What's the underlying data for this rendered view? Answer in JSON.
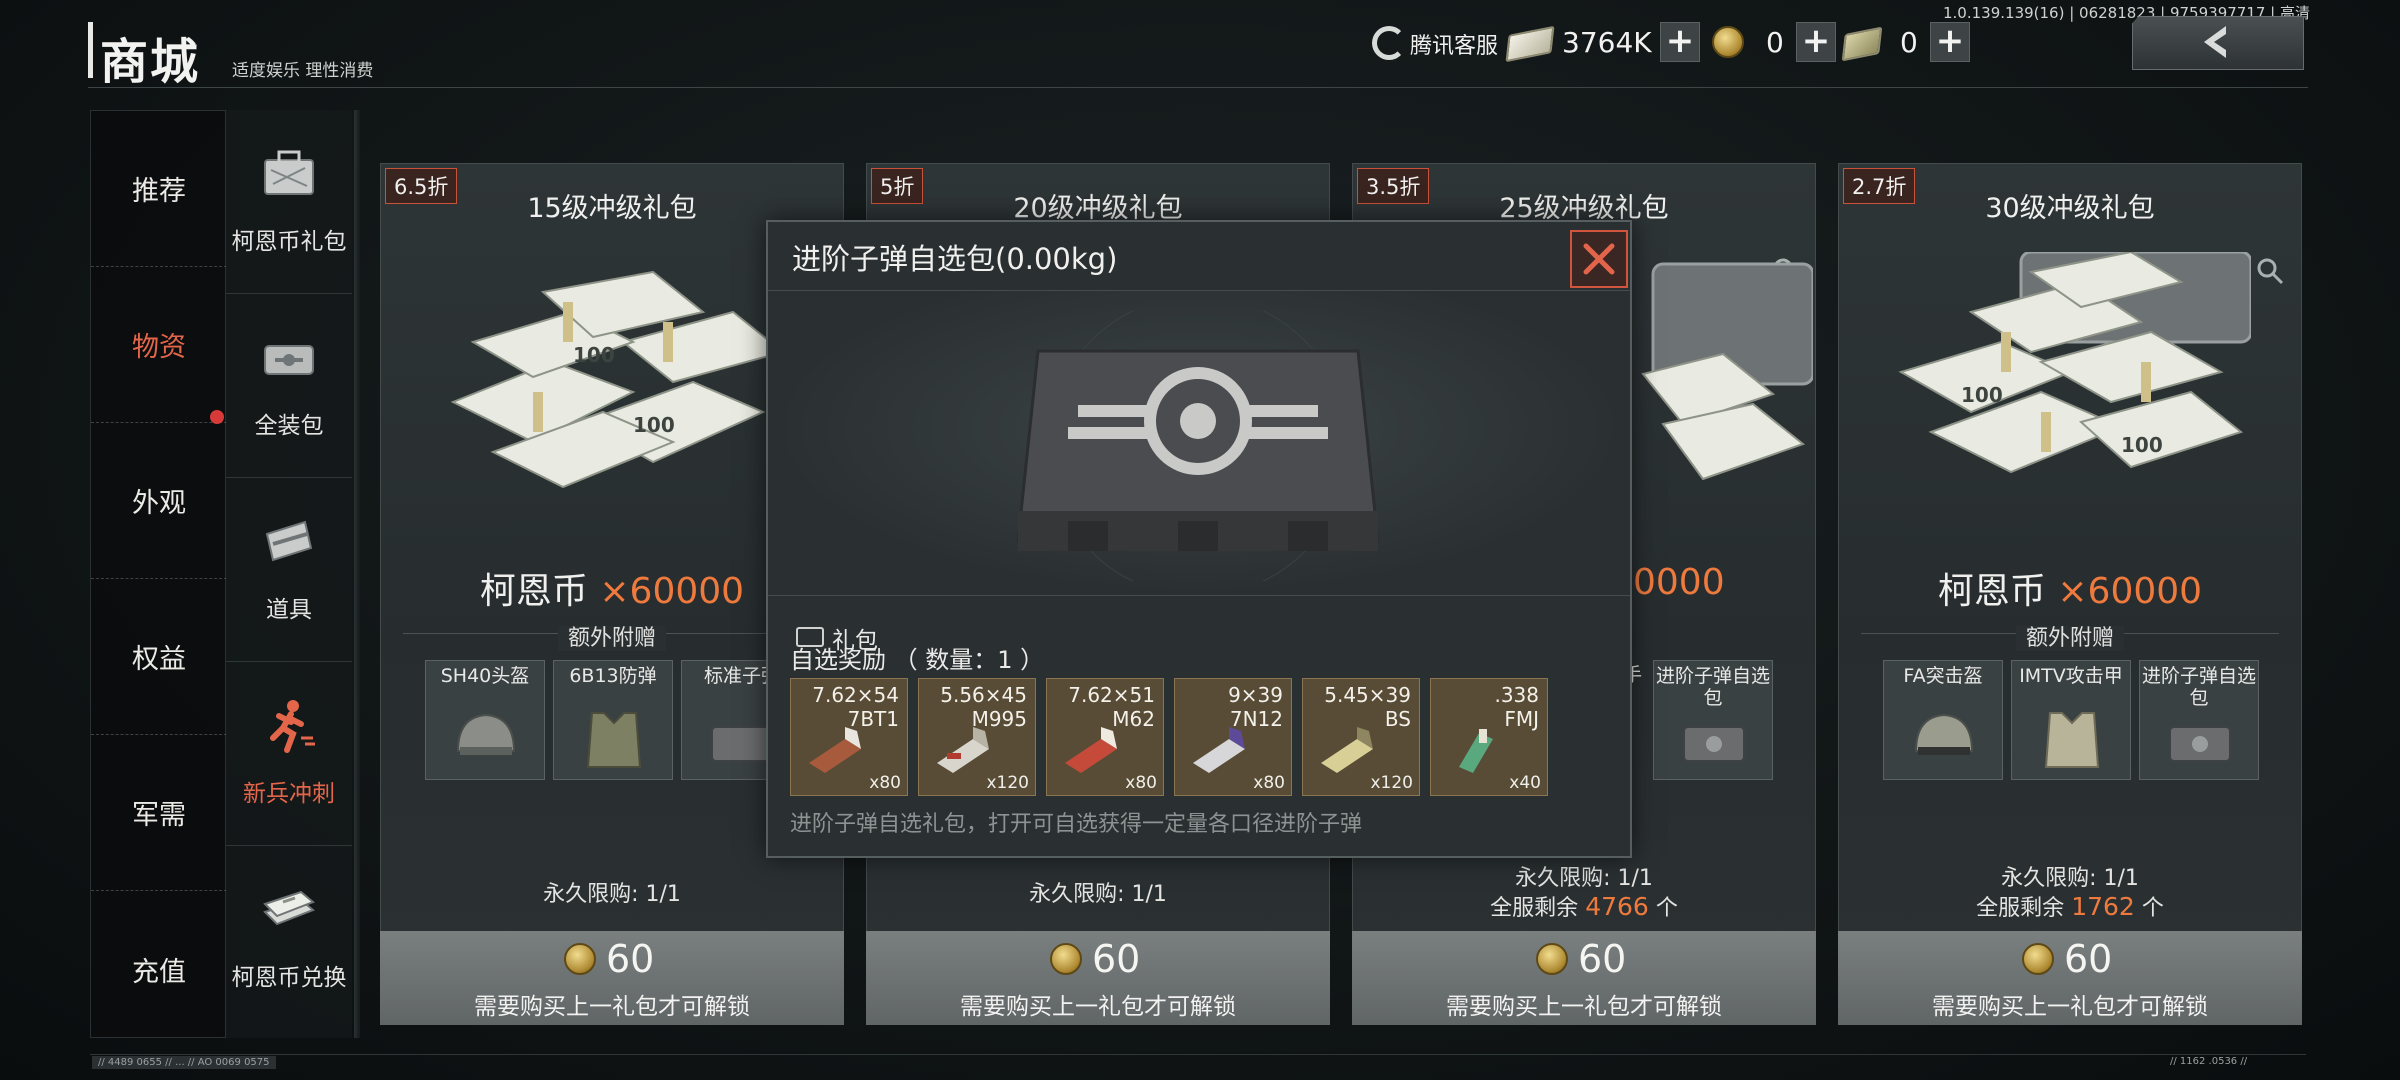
{
  "version": "1.0.139.139(16) | 06281823 | 9759397717 | 高清",
  "header": {
    "title": "商城",
    "subtitle": "适度娱乐 理性消费",
    "service_label": "腾讯客服",
    "cash_amount": "3764K",
    "coins": "0",
    "tickets": "0",
    "plus": "+"
  },
  "nav": {
    "items": [
      {
        "label": "推荐"
      },
      {
        "label": "物资"
      },
      {
        "label": "外观"
      },
      {
        "label": "权益"
      },
      {
        "label": "军需"
      },
      {
        "label": "充值"
      }
    ],
    "active": "物资"
  },
  "subnav": {
    "items": [
      {
        "label": "柯恩币礼包",
        "icon": "briefcase-icon"
      },
      {
        "label": "全装包",
        "icon": "crate-icon"
      },
      {
        "label": "道具",
        "icon": "card-icon"
      },
      {
        "label": "新兵冲刺",
        "icon": "runner-icon"
      },
      {
        "label": "柯恩币兑换",
        "icon": "cash-stack-icon"
      }
    ],
    "active": "新兵冲刺"
  },
  "cards": [
    {
      "discount": "6.5折",
      "title": "15级冲级礼包",
      "currency": "柯恩币",
      "multiplier": "×60000",
      "bonus_title": "额外附赠",
      "gifts": [
        "SH40头盔",
        "6B13防弹",
        "标准子弹"
      ],
      "limit": "永久限购: 1/1",
      "price": "60",
      "buy_hint": "需要购买上一礼包才可解锁"
    },
    {
      "discount": "5折",
      "title": "20级冲级礼包",
      "limit": "永久限购: 1/1",
      "price": "60",
      "buy_hint": "需要购买上一礼包才可解锁"
    },
    {
      "discount": "3.5折",
      "title": "25级冲级礼包",
      "amount_tail": "0000",
      "gift_tail": "进阶子弹自选包",
      "gift_tail_prefix": "手",
      "limit": "永久限购: 1/1",
      "remain_prefix": "全服剩余",
      "remain_count": "4766",
      "remain_unit": "个",
      "price": "60",
      "buy_hint": "需要购买上一礼包才可解锁"
    },
    {
      "discount": "2.7折",
      "title": "30级冲级礼包",
      "currency": "柯恩币",
      "multiplier": "×60000",
      "bonus_title": "额外附赠",
      "gifts": [
        "FA突击盔",
        "IMTV攻击甲",
        "进阶子弹自选包"
      ],
      "limit": "永久限购: 1/1",
      "remain_prefix": "全服剩余",
      "remain_count": "1762",
      "remain_unit": "个",
      "price": "60",
      "buy_hint": "需要购买上一礼包才可解锁"
    }
  ],
  "popup": {
    "title": "进阶子弹自选包(0.00kg)",
    "type": "礼包",
    "reward_title": "自选奖励 （ 数量：1 ）",
    "items": [
      {
        "caliber": "7.62×54\n7BT1",
        "qty": "x80"
      },
      {
        "caliber": "5.56×45\nM995",
        "qty": "x120"
      },
      {
        "caliber": "7.62×51\nM62",
        "qty": "x80"
      },
      {
        "caliber": "9×39\n7N12",
        "qty": "x80"
      },
      {
        "caliber": "5.45×39\nBS",
        "qty": "x120"
      },
      {
        "caliber": ".338\nFMJ",
        "qty": "x40"
      }
    ],
    "description": "进阶子弹自选礼包，打开可自选获得一定量各口径进阶子弹"
  },
  "footer": {
    "left_ticker": "// 4489 0655 // ... // AO 0069 0575",
    "right_ticker": "// 1162 .0536 //"
  },
  "colors": {
    "accent": "#ef7a3e",
    "active_nav": "#e4664a",
    "close_border": "#d0553c"
  }
}
